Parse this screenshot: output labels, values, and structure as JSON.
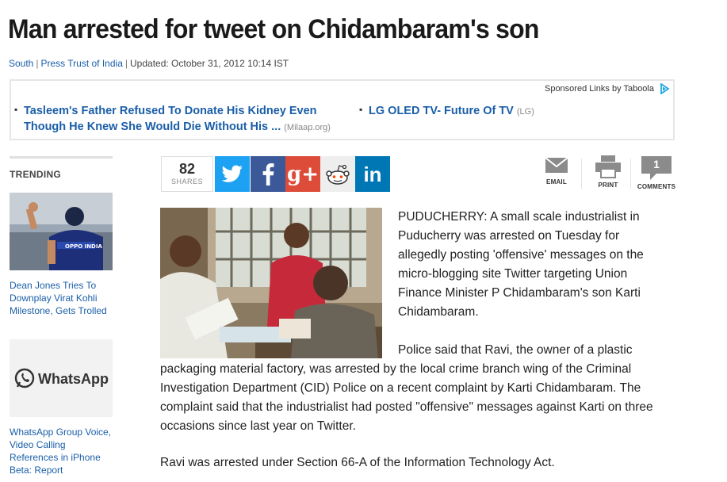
{
  "article": {
    "headline": "Man arrested for tweet on Chidambaram's son",
    "byline": {
      "section": "South",
      "source": "Press Trust of India",
      "updated": "Updated: October 31, 2012 10:14 IST"
    },
    "paragraph1": "PUDUCHERRY:  A small scale industrialist in Puducherry was arrested on Tuesday for allegedly posting 'offensive' messages on the micro-blogging site Twitter targeting Union Finance Minister P Chidambaram's son Karti Chidambaram.",
    "paragraph2_start": "Police said that Ravi, the owner of a plastic",
    "paragraph2_rest": "packaging material factory, was arrested by the local crime branch wing of the Criminal Investigation Department (CID) Police on a recent complaint by Karti Chidambaram. The complaint said that the industrialist had posted \"offensive\" messages against Karti on three occasions since last year on Twitter.",
    "paragraph3": "Ravi was arrested under Section 66-A of the Information Technology Act."
  },
  "sponsored": {
    "label": "Sponsored Links by Taboola",
    "items": [
      {
        "title": "Tasleem's Father Refused To Donate His Kidney Even Though He Knew She Would Die Without His ...",
        "source": "(Milaap.org)"
      },
      {
        "title": "LG OLED TV- Future Of TV",
        "source": "(LG)"
      }
    ]
  },
  "trending": {
    "label": "TRENDING",
    "items": [
      {
        "caption": "Dean Jones Tries To Downplay Virat Kohli Milestone, Gets Trolled",
        "jersey": "OPPO INDIA"
      },
      {
        "caption": "WhatsApp Group Voice, Video Calling References in iPhone Beta: Report",
        "logo_text": "WhatsApp"
      }
    ]
  },
  "share": {
    "count": "82",
    "count_label": "SHARES",
    "buttons": [
      {
        "name": "twitter",
        "icon": "twitter-bird-icon",
        "color": "#1da1f2"
      },
      {
        "name": "facebook",
        "icon": "facebook-f-icon",
        "color": "#3b5998"
      },
      {
        "name": "google-plus",
        "icon": "google-plus-icon",
        "color": "#dd4b39",
        "text": "g+"
      },
      {
        "name": "reddit",
        "icon": "reddit-alien-icon",
        "color": "#eeeeee"
      },
      {
        "name": "linkedin",
        "icon": "linkedin-icon",
        "color": "#0077b5",
        "text": "in"
      }
    ]
  },
  "tools": {
    "email_label": "EMAIL",
    "print_label": "PRINT",
    "comments_label": "COMMENTS",
    "comments_count": "1"
  }
}
